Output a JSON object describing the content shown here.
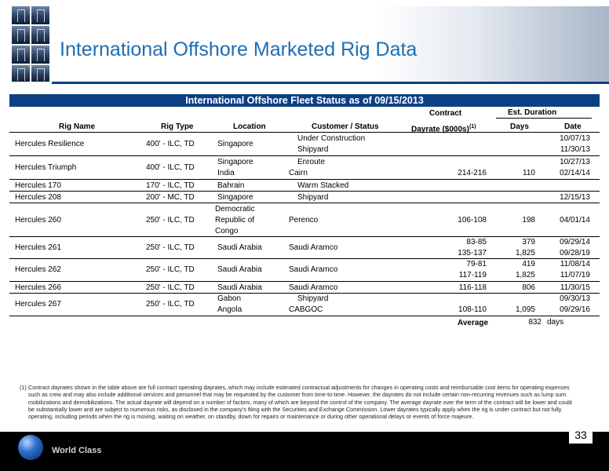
{
  "title": "International Offshore Marketed Rig Data",
  "table": {
    "heading": "International Offshore Fleet Status as of 09/15/2013",
    "col_headers": {
      "contract": "Contract",
      "est_duration": "Est. Duration",
      "rig_name": "Rig Name",
      "rig_type": "Rig Type",
      "location": "Location",
      "customer_status": "Customer / Status",
      "dayrate": "Dayrate ($000s)",
      "dayrate_sup": "(1)",
      "days": "Days",
      "date": "Date"
    },
    "rows": {
      "r1": {
        "name": "Hercules Resilience",
        "type": "400' - ILC, TD",
        "location": "Singapore",
        "status1": "Under Construction",
        "status2": "Shipyard",
        "date1": "10/07/13",
        "date2": "11/30/13"
      },
      "r2": {
        "name": "Hercules Triumph",
        "type": "400' - ILC, TD",
        "location1": "Singapore",
        "location2": "India",
        "status1": "Enroute",
        "status2": "Cairn",
        "dayrate2": "214-216",
        "days2": "110",
        "date1": "10/27/13",
        "date2": "02/14/14"
      },
      "r3": {
        "name": "Hercules 170",
        "type": "170' - ILC, TD",
        "location": "Bahrain",
        "status": "Warm Stacked"
      },
      "r4": {
        "name": "Hercules 208",
        "type": "200' - MC, TD",
        "location": "Singapore",
        "status": "Shipyard",
        "date": "12/15/13"
      },
      "r5": {
        "name": "Hercules 260",
        "type": "250' - ILC, TD",
        "location1": "Democratic",
        "location2": "Republic of",
        "location3": "Congo",
        "status": "Perenco",
        "dayrate": "106-108",
        "days": "198",
        "date": "04/01/14"
      },
      "r6": {
        "name": "Hercules 261",
        "type": "250' - ILC, TD",
        "location": "Saudi Arabia",
        "status": "Saudi Aramco",
        "dayrate1": "83-85",
        "dayrate2": "135-137",
        "days1": "379",
        "days2": "1,825",
        "date1": "09/29/14",
        "date2": "09/28/19"
      },
      "r7": {
        "name": "Hercules 262",
        "type": "250' - ILC, TD",
        "location": "Saudi Arabia",
        "status": "Saudi Aramco",
        "dayrate1": "79-81",
        "dayrate2": "117-119",
        "days1": "419",
        "days2": "1,825",
        "date1": "11/08/14",
        "date2": "11/07/19"
      },
      "r8": {
        "name": "Hercules 266",
        "type": "250' - ILC, TD",
        "location": "Saudi Arabia",
        "status": "Saudi Aramco",
        "dayrate": "116-118",
        "days": "806",
        "date": "11/30/15"
      },
      "r9": {
        "name": "Hercules 267",
        "type": "250' - ILC, TD",
        "location1": "Gabon",
        "location2": "Angola",
        "status1": "Shipyard",
        "status2": "CABGOC",
        "dayrate2": "108-110",
        "days2": "1,095",
        "date1": "09/30/13",
        "date2": "09/29/16"
      }
    },
    "average": {
      "label": "Average",
      "value": "832",
      "unit": "days"
    }
  },
  "footnote": {
    "num": "(1)",
    "text": "Contract dayrates shown in the table above are full contract operating dayrates, which may include estimated contractual adjustments for changes in operating costs and reimbursable cost items for operating expenses such as crew and may also include additional services and personnel that may be requested by the customer from time-to-time. However, the dayrates do not include certain non-recurring revenues such as lump sum mobilizations and demobilizations. The actual dayrate will depend on a number of factors, many of which are beyond the control of the company. The average dayrate over the term of the contract will be lower and could be substantially lower and are subject to numerous risks, as disclosed in the company's filing with the Securities and Exchange Commission. Lower dayrates typically apply when the rig is under contract but not fully operating, including periods when the rig is moving, waiting on weather, on standby, down for repairs or maintenance or during other operational delays or events of force majeure."
  },
  "footer": {
    "tagline": "World Class",
    "page_number": "33"
  },
  "colors": {
    "title": "#1f6db3",
    "navy": "#0d3f84"
  }
}
